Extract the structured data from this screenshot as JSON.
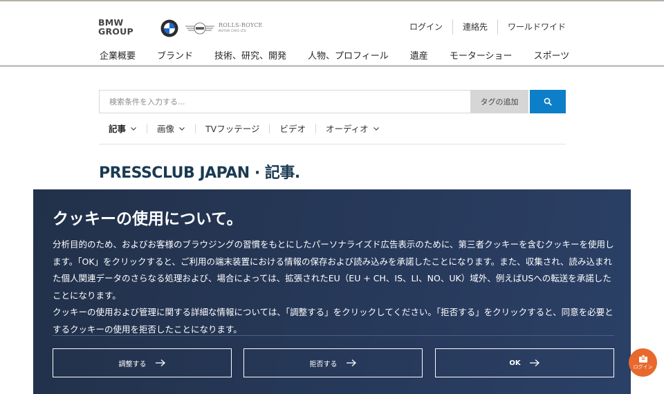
{
  "header": {
    "brand": {
      "line1": "BMW",
      "line2": "GROUP"
    },
    "rolls_royce": {
      "name": "ROLLS-ROYCE",
      "sub": "MOTOR CARS LTD"
    },
    "util_links": [
      "ログイン",
      "連絡先",
      "ワールドワイド"
    ],
    "nav": [
      "企業概要",
      "ブランド",
      "技術、研究、開発",
      "人物、プロフィール",
      "遺産",
      "モーターショー",
      "スポーツ"
    ]
  },
  "search": {
    "placeholder": "検索条件を入力する...",
    "tag_label": "タグの追加"
  },
  "filters": [
    {
      "label": "記事",
      "dropdown": true,
      "active": true
    },
    {
      "label": "画像",
      "dropdown": true,
      "active": false
    },
    {
      "label": "TVフッテージ",
      "dropdown": false,
      "active": false
    },
    {
      "label": "ビデオ",
      "dropdown": false,
      "active": false
    },
    {
      "label": "オーディオ",
      "dropdown": true,
      "active": false
    }
  ],
  "page_title": "PRESSCLUB JAPAN · 記事.",
  "cookie": {
    "title": "クッキーの使用について。",
    "paragraphs": [
      "分析目的のため、およびお客様のブラウジングの習慣をもとにしたパーソナライズド広告表示のために、第三者クッキーを含むクッキーを使用します。「OK」をクリックすると、ご利用の端末装置における情報の保存および読み込みを承諾したことになります。また、収集され、読み込まれた個人関連データのさらなる処理および、場合によっては、拡張されたEU（EU + CH、IS、LI、NO、UK）域外、例えばUSへの転送を承諾したことになります。",
      "クッキーの使用および管理に関する詳細な情報については、「調整する」をクリックしてください。「拒否する」をクリックすると、同意を必要とするクッキーの使用を拒否したことになります。"
    ],
    "buttons": {
      "adjust": "調整する",
      "reject": "拒否する",
      "ok": "OK"
    }
  },
  "login_fab": {
    "label": "ログイン"
  },
  "colors": {
    "accent": "#0d7ec8",
    "banner": "#27395a",
    "fab": "#e8692d",
    "title": "#1a3a52"
  },
  "icons": [
    "bmw-roundel-icon",
    "mini-logo-icon",
    "search-icon",
    "chevron-down-icon",
    "arrow-right-icon",
    "user-icon"
  ]
}
